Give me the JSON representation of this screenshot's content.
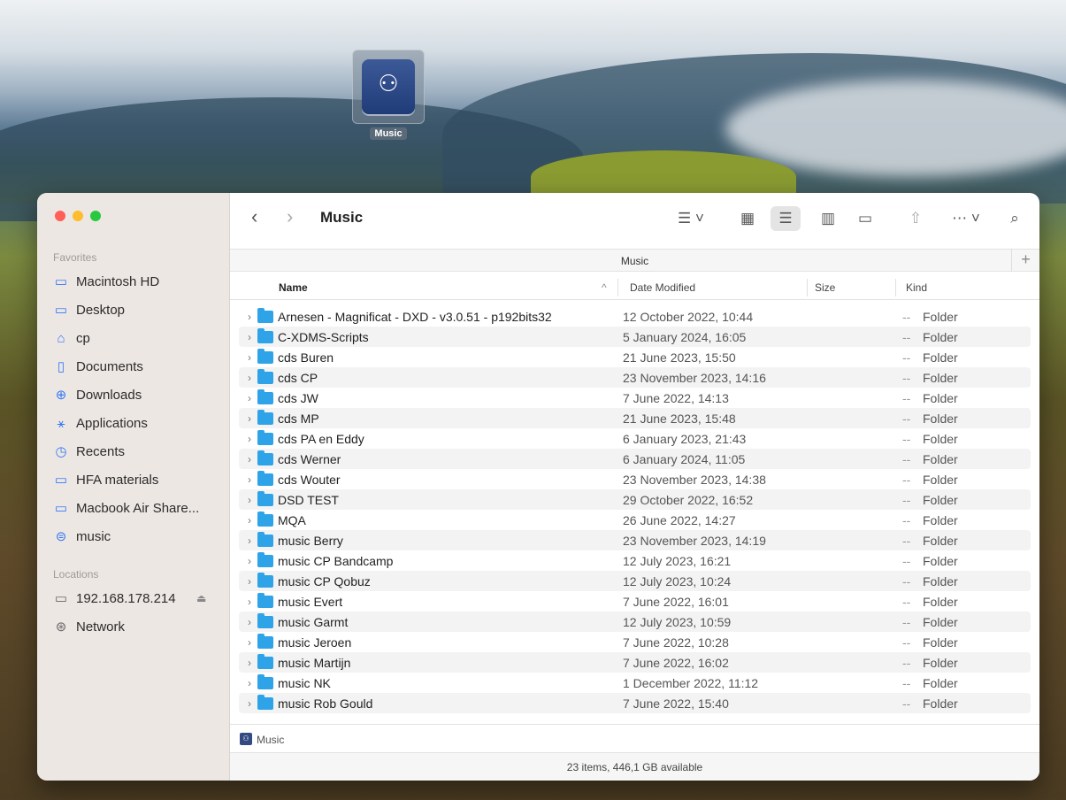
{
  "desktop": {
    "icon_label": "Music"
  },
  "window": {
    "title": "Music",
    "traffic_colors": [
      "#ff5f57",
      "#febc2e",
      "#28c840"
    ]
  },
  "sidebar": {
    "favorites_label": "Favorites",
    "favorites": [
      {
        "label": "Macintosh HD",
        "icon": "drive-icon"
      },
      {
        "label": "Desktop",
        "icon": "desktop-icon"
      },
      {
        "label": "cp",
        "icon": "home-icon"
      },
      {
        "label": "Documents",
        "icon": "document-icon"
      },
      {
        "label": "Downloads",
        "icon": "download-icon"
      },
      {
        "label": "Applications",
        "icon": "applications-icon"
      },
      {
        "label": "Recents",
        "icon": "clock-icon"
      },
      {
        "label": "HFA materials",
        "icon": "folder-icon"
      },
      {
        "label": "Macbook Air Share...",
        "icon": "folder-icon"
      },
      {
        "label": "music",
        "icon": "network-drive-icon"
      }
    ],
    "locations_label": "Locations",
    "locations": [
      {
        "label": "192.168.178.214",
        "icon": "display-icon"
      },
      {
        "label": "Network",
        "icon": "globe-icon"
      }
    ]
  },
  "pathbar": {
    "title": "Music"
  },
  "columns": {
    "name": "Name",
    "date": "Date Modified",
    "size": "Size",
    "kind": "Kind"
  },
  "rows": [
    {
      "name": "Arnesen - Magnificat - DXD - v3.0.51 - p192bits32",
      "date": "12 October 2022, 10:44",
      "size": "--",
      "kind": "Folder"
    },
    {
      "name": "C-XDMS-Scripts",
      "date": "5 January 2024, 16:05",
      "size": "--",
      "kind": "Folder"
    },
    {
      "name": "cds Buren",
      "date": "21 June 2023, 15:50",
      "size": "--",
      "kind": "Folder"
    },
    {
      "name": "cds CP",
      "date": "23 November 2023, 14:16",
      "size": "--",
      "kind": "Folder"
    },
    {
      "name": "cds JW",
      "date": "7 June 2022, 14:13",
      "size": "--",
      "kind": "Folder"
    },
    {
      "name": "cds MP",
      "date": "21 June 2023, 15:48",
      "size": "--",
      "kind": "Folder"
    },
    {
      "name": "cds PA en Eddy",
      "date": "6 January 2023, 21:43",
      "size": "--",
      "kind": "Folder"
    },
    {
      "name": "cds Werner",
      "date": "6 January 2024, 11:05",
      "size": "--",
      "kind": "Folder"
    },
    {
      "name": "cds Wouter",
      "date": "23 November 2023, 14:38",
      "size": "--",
      "kind": "Folder"
    },
    {
      "name": "DSD TEST",
      "date": "29 October 2022, 16:52",
      "size": "--",
      "kind": "Folder"
    },
    {
      "name": "MQA",
      "date": "26 June 2022, 14:27",
      "size": "--",
      "kind": "Folder"
    },
    {
      "name": "music Berry",
      "date": "23 November 2023, 14:19",
      "size": "--",
      "kind": "Folder"
    },
    {
      "name": "music CP Bandcamp",
      "date": "12 July 2023, 16:21",
      "size": "--",
      "kind": "Folder"
    },
    {
      "name": "music CP Qobuz",
      "date": "12 July 2023, 10:24",
      "size": "--",
      "kind": "Folder"
    },
    {
      "name": "music Evert",
      "date": "7 June 2022, 16:01",
      "size": "--",
      "kind": "Folder"
    },
    {
      "name": "music Garmt",
      "date": "12 July 2023, 10:59",
      "size": "--",
      "kind": "Folder"
    },
    {
      "name": "music Jeroen",
      "date": "7 June 2022, 10:28",
      "size": "--",
      "kind": "Folder"
    },
    {
      "name": "music Martijn",
      "date": "7 June 2022, 16:02",
      "size": "--",
      "kind": "Folder"
    },
    {
      "name": "music NK",
      "date": "1 December 2022, 11:12",
      "size": "--",
      "kind": "Folder"
    },
    {
      "name": "music Rob Gould",
      "date": "7 June 2022, 15:40",
      "size": "--",
      "kind": "Folder"
    }
  ],
  "bottom_path": {
    "label": "Music"
  },
  "status": {
    "text": "23 items, 446,1 GB available"
  }
}
